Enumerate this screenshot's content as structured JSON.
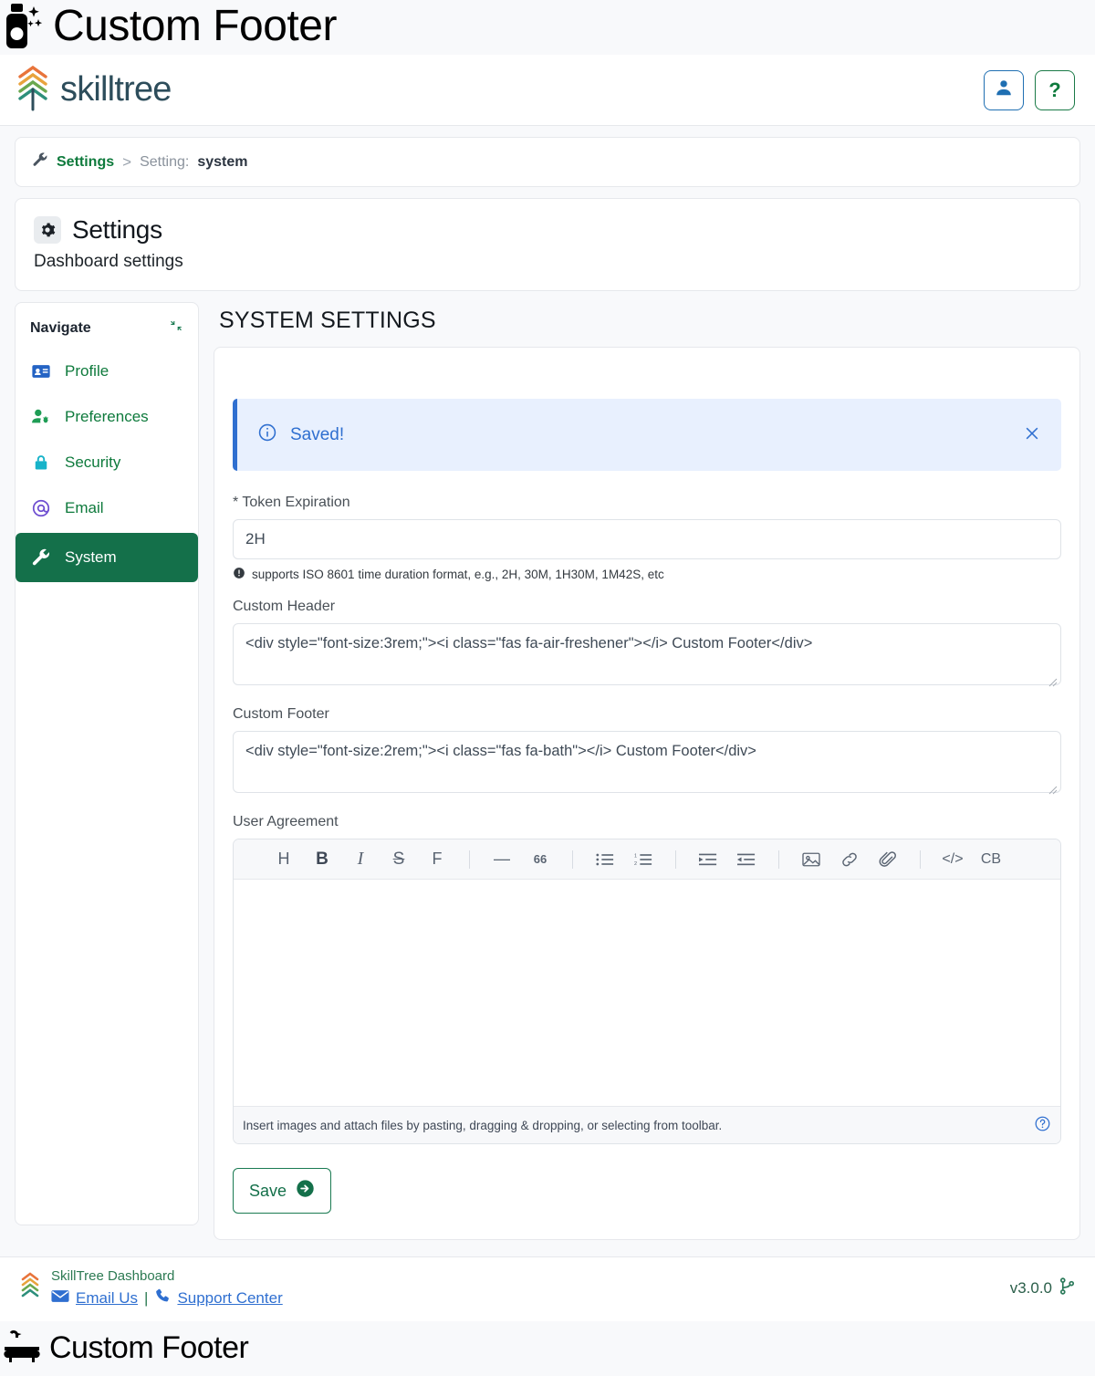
{
  "custom_header_band": {
    "icon": "air-freshener-icon",
    "text": "Custom Footer"
  },
  "custom_footer_band": {
    "icon": "bath-icon",
    "text": "Custom Footer"
  },
  "navbar": {
    "brand_name": "skilltree",
    "brand_icon": "skilltree-logo-icon",
    "user_button_icon": "user-icon",
    "help_button_label": "?"
  },
  "breadcrumb": {
    "icon": "wrench-icon",
    "root_label": "Settings",
    "separator": ">",
    "current_prefix": "Setting: ",
    "current_value": "system"
  },
  "page_header": {
    "icon": "gear-icon",
    "title": "Settings",
    "subtitle": "Dashboard settings"
  },
  "sidebar": {
    "title": "Navigate",
    "collapse_icon": "compress-arrows-icon",
    "items": [
      {
        "label": "Profile",
        "icon": "id-card-icon",
        "active": false
      },
      {
        "label": "Preferences",
        "icon": "user-gear-icon",
        "active": false
      },
      {
        "label": "Security",
        "icon": "lock-icon",
        "active": false
      },
      {
        "label": "Email",
        "icon": "at-icon",
        "active": false
      },
      {
        "label": "System",
        "icon": "wrench-icon",
        "active": true
      }
    ]
  },
  "main": {
    "section_title": "SYSTEM SETTINGS",
    "alert": {
      "icon": "info-circle-icon",
      "message": "Saved!",
      "close_icon": "close-icon"
    },
    "token_expiration": {
      "label": "* Token Expiration",
      "value": "2H",
      "placeholder": "",
      "help_icon": "info-icon",
      "help_text": "supports ISO 8601 time duration format, e.g., 2H, 30M, 1H30M, 1M42S, etc"
    },
    "custom_header": {
      "label": "Custom Header",
      "value": "<div style=\"font-size:3rem;\"><i class=\"fas fa-air-freshener\"></i> Custom Footer</div>",
      "placeholder": ""
    },
    "custom_footer": {
      "label": "Custom Footer",
      "value": "<div style=\"font-size:2rem;\"><i class=\"fas fa-bath\"></i> Custom Footer</div>",
      "placeholder": ""
    },
    "user_agreement": {
      "label": "User Agreement",
      "value": "",
      "toolbar": [
        {
          "name": "header",
          "glyph": "H"
        },
        {
          "name": "bold",
          "glyph": "B"
        },
        {
          "name": "italic",
          "glyph": "I"
        },
        {
          "name": "strikethrough",
          "glyph": "S"
        },
        {
          "name": "font",
          "glyph": "F"
        },
        {
          "name": "horizontal-rule",
          "glyph": "—"
        },
        {
          "name": "blockquote",
          "glyph": "66"
        },
        {
          "name": "bullet-list",
          "glyph": ""
        },
        {
          "name": "numbered-list",
          "glyph": ""
        },
        {
          "name": "indent",
          "glyph": ""
        },
        {
          "name": "outdent",
          "glyph": ""
        },
        {
          "name": "image",
          "glyph": ""
        },
        {
          "name": "link",
          "glyph": ""
        },
        {
          "name": "attachment",
          "glyph": ""
        },
        {
          "name": "inline-code",
          "glyph": "</>"
        },
        {
          "name": "code-block",
          "glyph": "CB"
        }
      ],
      "footer_hint": "Insert images and attach files by pasting, dragging & dropping, or selecting from toolbar.",
      "footer_help_icon": "question-circle-icon"
    },
    "save_button": {
      "label": "Save",
      "icon": "arrow-circle-right-icon"
    }
  },
  "footer": {
    "logo_icon": "skilltree-mark-icon",
    "dashboard_label": "SkillTree Dashboard",
    "email_icon": "envelope-icon",
    "email_label": "Email Us",
    "divider": "|",
    "support_icon": "phone-icon",
    "support_label": "Support Center",
    "version": "v3.0.0",
    "version_icon": "code-branch-icon"
  },
  "colors": {
    "brand_green": "#0e7a3c",
    "active_green": "#14704a",
    "link_blue": "#2f6fd0",
    "alert_bg": "#e8f0fe",
    "page_bg": "#f8f9fb"
  }
}
